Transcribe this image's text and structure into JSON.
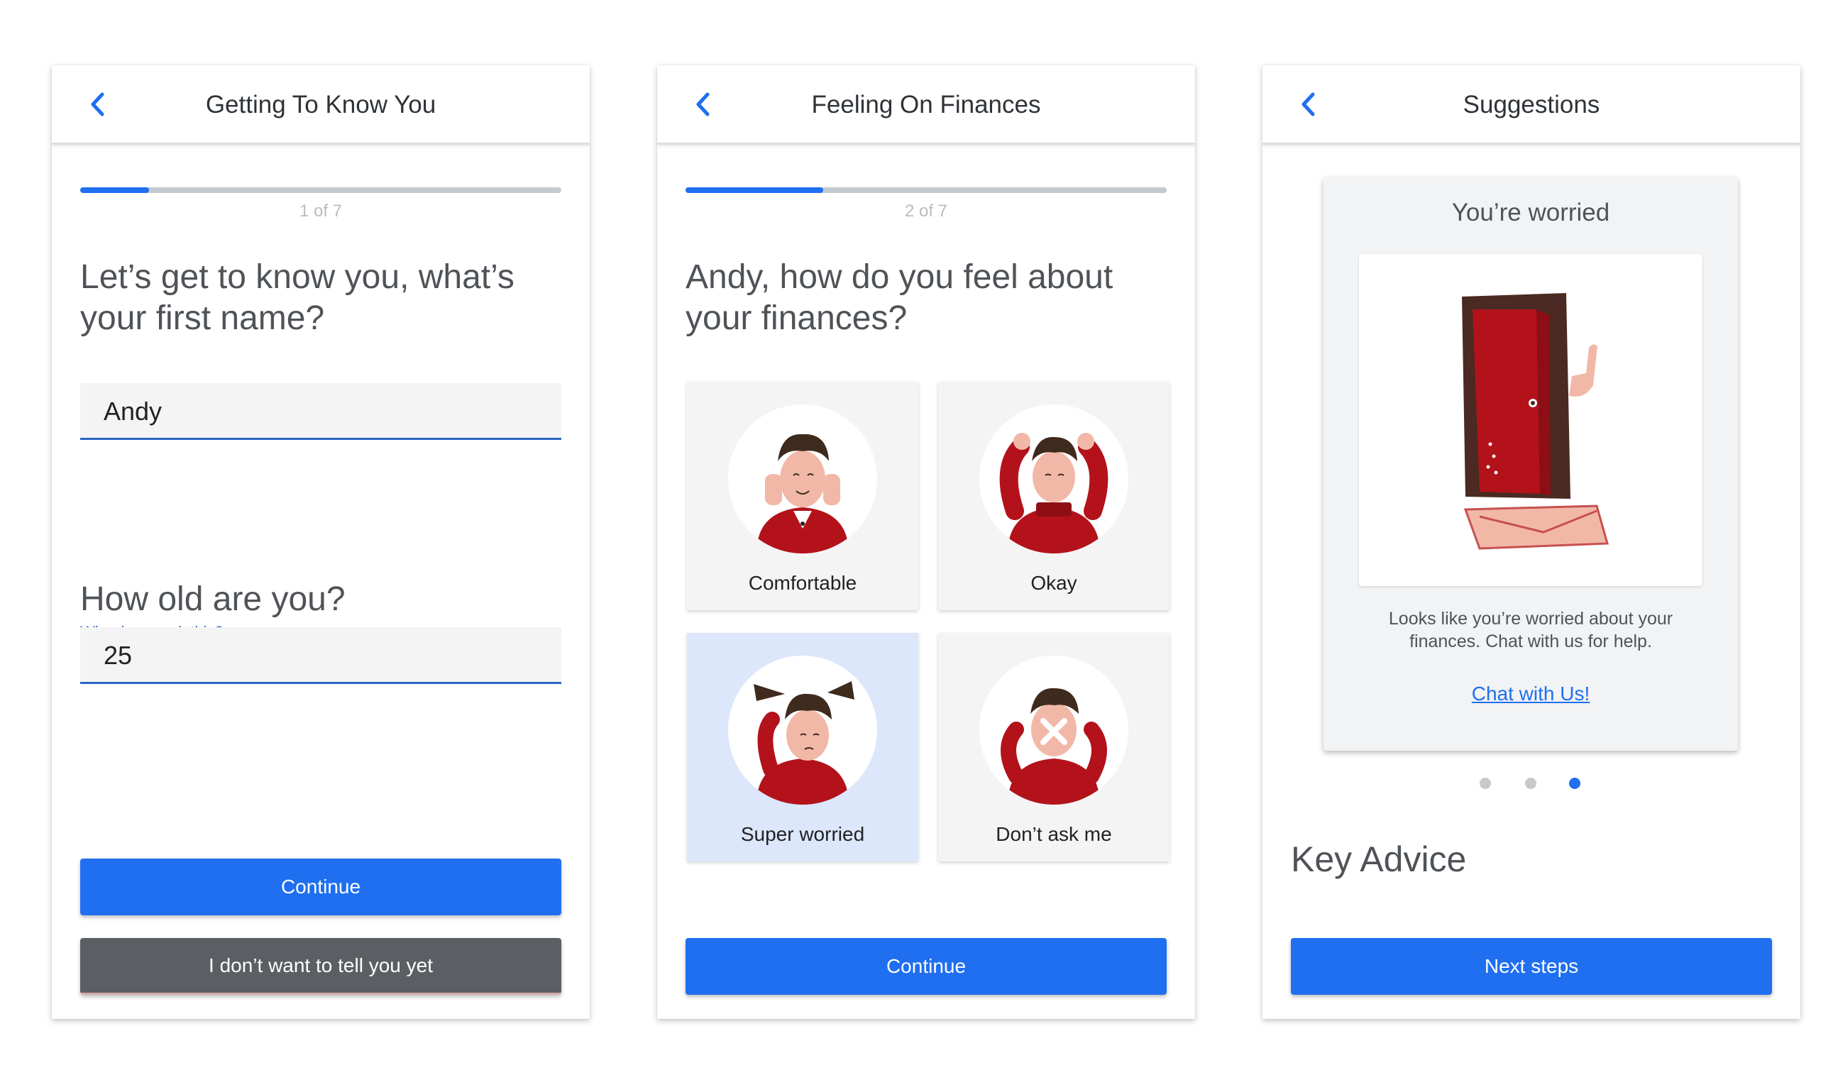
{
  "colors": {
    "accent": "#1f6ff0",
    "secondary_button": "#5b5e62",
    "selected_option": "#dce7fb",
    "illustration_red": "#b3121b"
  },
  "screen1": {
    "back_icon": "chevron-left-icon",
    "title": "Getting To Know You",
    "progress": {
      "label": "1 of 7",
      "fraction": 0.142857
    },
    "question1": "Let’s get to know you, what’s your first name?",
    "name_value": "Andy",
    "question2": "How old are you?",
    "why_link": "Why do we ask this?",
    "age_value": "25",
    "continue_label": "Continue",
    "decline_label": "I don’t want to tell you yet"
  },
  "screen2": {
    "back_icon": "chevron-left-icon",
    "title": "Feeling On Finances",
    "progress": {
      "label": "2 of 7",
      "fraction": 0.285714
    },
    "question": "Andy, how do you feel about your finances?",
    "options": [
      {
        "label": "Comfortable",
        "icon": "comfortable-person-icon",
        "selected": false
      },
      {
        "label": "Okay",
        "icon": "okay-person-icon",
        "selected": false
      },
      {
        "label": "Super worried",
        "icon": "super-worried-person-icon",
        "selected": true
      },
      {
        "label": "Don’t ask me",
        "icon": "dont-ask-me-person-icon",
        "selected": false
      }
    ],
    "continue_label": "Continue"
  },
  "screen3": {
    "back_icon": "chevron-left-icon",
    "title": "Suggestions",
    "card": {
      "title": "You’re worried",
      "illustration": "door-peek-icon",
      "body": "Looks like you’re worried about your finances. Chat with us for help.",
      "link": "Chat with Us!"
    },
    "carousel": {
      "count": 3,
      "active_index": 2
    },
    "section_title": "Key Advice",
    "next_label": "Next steps"
  }
}
